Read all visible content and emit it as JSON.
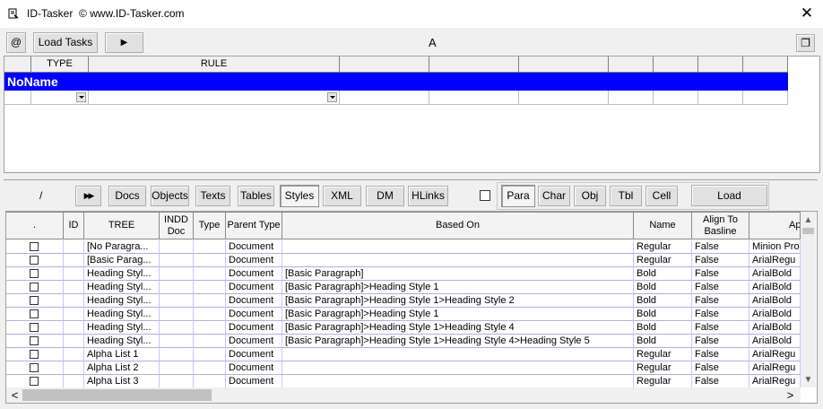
{
  "window": {
    "title": "ID-Tasker",
    "subtitle": "© www.ID-Tasker.com",
    "close_glyph": "✕"
  },
  "toolbar": {
    "at_label": "@",
    "load_tasks_label": "Load Tasks",
    "play_glyph": "▶",
    "center_label": "A",
    "restore_glyph": "❐"
  },
  "task_grid": {
    "columns": [
      "",
      "TYPE",
      "RULE",
      "",
      "",
      "",
      "",
      "",
      "",
      ""
    ],
    "selected_row_label": "NoName"
  },
  "style_toolbar": {
    "slash_label": "/",
    "fast_forward_glyph": "▶▶",
    "tabs": [
      "Docs",
      "Objects",
      "Texts",
      "Tables",
      "Styles",
      "XML",
      "DM",
      "HLinks"
    ],
    "selected_tab": "Styles",
    "subtabs": [
      "Para",
      "Char",
      "Obj",
      "Tbl",
      "Cell"
    ],
    "selected_subtab": "Para",
    "load_label": "Load"
  },
  "styles_grid": {
    "headers": [
      ".",
      "ID",
      "TREE",
      "INDD Doc",
      "Type",
      "Parent Type",
      "Based On",
      "Name",
      "Align To Basline",
      "Ap"
    ],
    "rows": [
      {
        "tree": "[No Paragra...",
        "parent_type": "Document",
        "based_on": "",
        "name": "Regular",
        "align": "False",
        "font": "Minion Pro"
      },
      {
        "tree": "[Basic Parag...",
        "parent_type": "Document",
        "based_on": "",
        "name": "Regular",
        "align": "False",
        "font": "ArialRegu"
      },
      {
        "tree": "Heading Styl...",
        "parent_type": "Document",
        "based_on": "[Basic Paragraph]",
        "name": "Bold",
        "align": "False",
        "font": "ArialBold"
      },
      {
        "tree": "Heading Styl...",
        "parent_type": "Document",
        "based_on": "[Basic Paragraph]>Heading Style 1",
        "name": "Bold",
        "align": "False",
        "font": "ArialBold"
      },
      {
        "tree": "Heading Styl...",
        "parent_type": "Document",
        "based_on": "[Basic Paragraph]>Heading Style 1>Heading Style 2",
        "name": "Bold",
        "align": "False",
        "font": "ArialBold"
      },
      {
        "tree": "Heading Styl...",
        "parent_type": "Document",
        "based_on": "[Basic Paragraph]>Heading Style 1",
        "name": "Bold",
        "align": "False",
        "font": "ArialBold"
      },
      {
        "tree": "Heading Styl...",
        "parent_type": "Document",
        "based_on": "[Basic Paragraph]>Heading Style 1>Heading Style 4",
        "name": "Bold",
        "align": "False",
        "font": "ArialBold"
      },
      {
        "tree": "Heading Styl...",
        "parent_type": "Document",
        "based_on": "[Basic Paragraph]>Heading Style 1>Heading Style 4>Heading Style 5",
        "name": "Bold",
        "align": "False",
        "font": "ArialBold"
      },
      {
        "tree": "Alpha List 1",
        "parent_type": "Document",
        "based_on": "",
        "name": "Regular",
        "align": "False",
        "font": "ArialRegu"
      },
      {
        "tree": "Alpha List 2",
        "parent_type": "Document",
        "based_on": "",
        "name": "Regular",
        "align": "False",
        "font": "ArialRegu"
      },
      {
        "tree": "Alpha List 3",
        "parent_type": "Document",
        "based_on": "",
        "name": "Regular",
        "align": "False",
        "font": "ArialRegu"
      }
    ]
  },
  "scroll": {
    "up": "▲",
    "down": "▼",
    "left": "<",
    "right": ">"
  },
  "colors": {
    "selected_row": "#0000ff",
    "grid_line": "#b0b0e0"
  }
}
